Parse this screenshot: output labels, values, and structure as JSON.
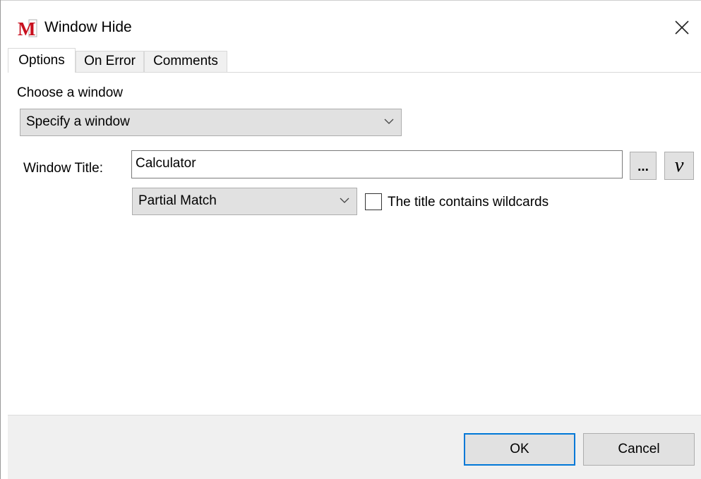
{
  "window": {
    "title": "Window Hide",
    "close_icon": "close-x-icon",
    "app_icon": "macro-m-icon",
    "app_icon_letter": "M"
  },
  "tabs": [
    {
      "label": "Options",
      "active": true
    },
    {
      "label": "On Error",
      "active": false
    },
    {
      "label": "Comments",
      "active": false
    }
  ],
  "options": {
    "choose_label": "Choose a window",
    "choose_value": "Specify a window",
    "window_title_label": "Window Title:",
    "window_title_value": "Calculator",
    "browse_label": "...",
    "variable_label": "v",
    "match_value": "Partial Match",
    "wildcards_label": "The title contains wildcards",
    "wildcards_checked": false
  },
  "buttons": {
    "ok": "OK",
    "cancel": "Cancel"
  },
  "colors": {
    "default_button_border": "#0078d7",
    "app_icon_red": "#c8101e"
  }
}
